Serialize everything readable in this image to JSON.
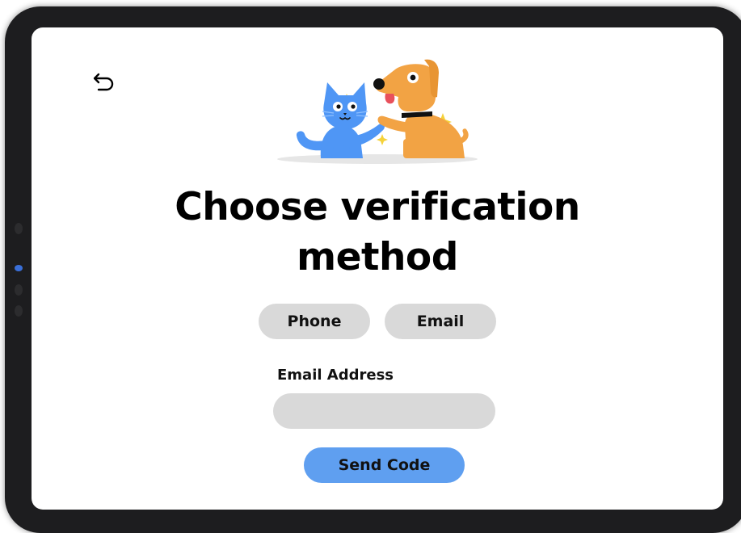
{
  "header": {
    "back_icon": "undo-arrow-icon",
    "illustration": "cat-and-dog-high-five"
  },
  "title": {
    "line1": "Choose verification",
    "line2": "method"
  },
  "methods": [
    {
      "label": "Phone"
    },
    {
      "label": "Email"
    }
  ],
  "email": {
    "label": "Email Address",
    "value": "",
    "placeholder": ""
  },
  "send": {
    "label": "Send Code"
  },
  "colors": {
    "button_gray": "#d9d9d9",
    "send_blue": "#5f9ff0",
    "cat_blue": "#4f96f5",
    "dog_orange": "#f2a344",
    "sparkle_yellow": "#f5d23a"
  }
}
